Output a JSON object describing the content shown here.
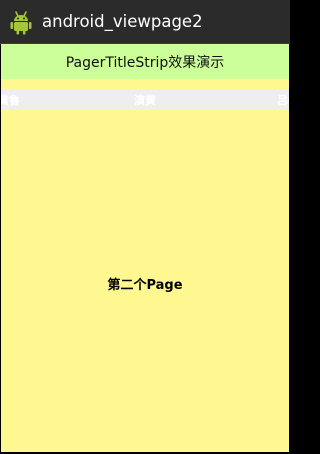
{
  "app": {
    "title": "android_viewpage2",
    "icon": "android-robot-icon"
  },
  "header": {
    "title": "PagerTitleStrip效果演示"
  },
  "pager_title_strip": {
    "prev_title": "黄鲁",
    "current_title": "演黄",
    "next_title": "吕保"
  },
  "page": {
    "text": "第二个Page"
  },
  "colors": {
    "action_bar": "#2b2b2b",
    "header_bar": "#ccff99",
    "title_strip": "#eeeeee",
    "page_background": "#fff78f"
  }
}
